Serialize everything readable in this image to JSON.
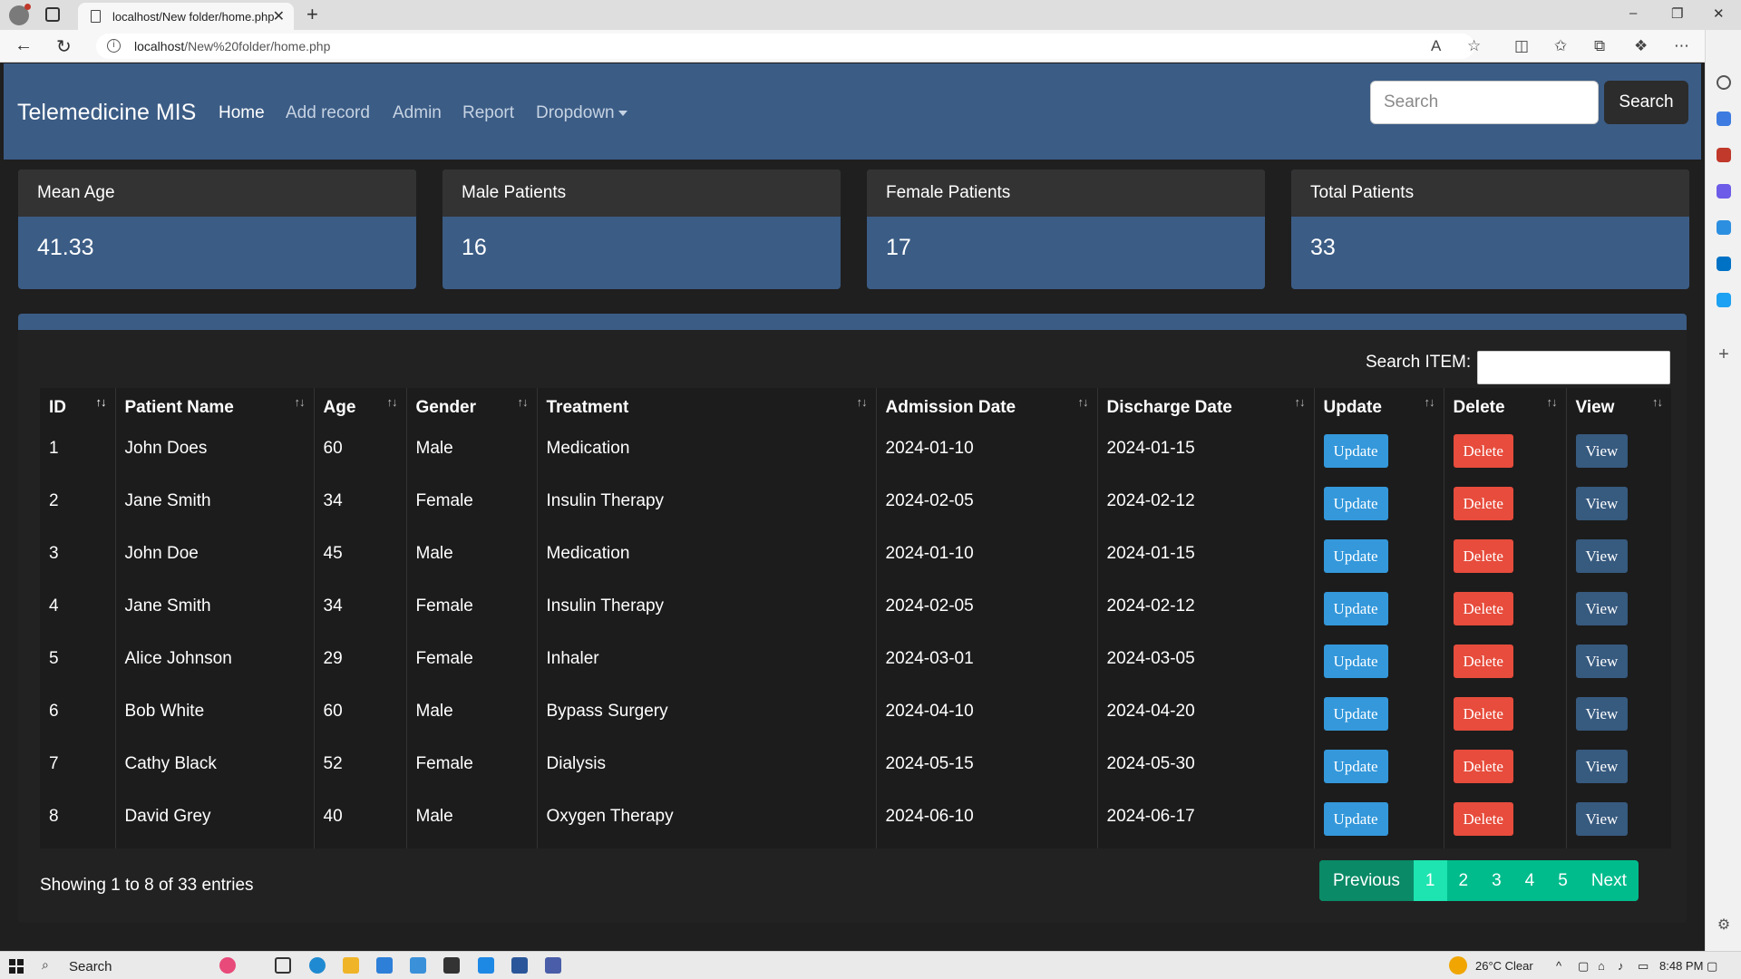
{
  "browser": {
    "tab_title": "localhost/New folder/home.php",
    "url_host": "localhost",
    "url_path": "/New%20folder/home.php"
  },
  "navbar": {
    "brand": "Telemedicine MIS",
    "links": [
      "Home",
      "Add record",
      "Admin",
      "Report",
      "Dropdown"
    ],
    "search_placeholder": "Search",
    "search_button": "Search"
  },
  "stats": [
    {
      "label": "Mean Age",
      "value": "41.33"
    },
    {
      "label": "Male Patients",
      "value": "16"
    },
    {
      "label": "Female Patients",
      "value": "17"
    },
    {
      "label": "Total Patients",
      "value": "33"
    }
  ],
  "table": {
    "search_label": "Search ITEM:",
    "columns": [
      "ID",
      "Patient Name",
      "Age",
      "Gender",
      "Treatment",
      "Admission Date",
      "Discharge Date",
      "Update",
      "Delete",
      "View"
    ],
    "rows": [
      [
        "1",
        "John Does",
        "60",
        "Male",
        "Medication",
        "2024-01-10",
        "2024-01-15"
      ],
      [
        "2",
        "Jane Smith",
        "34",
        "Female",
        "Insulin Therapy",
        "2024-02-05",
        "2024-02-12"
      ],
      [
        "3",
        "John Doe",
        "45",
        "Male",
        "Medication",
        "2024-01-10",
        "2024-01-15"
      ],
      [
        "4",
        "Jane Smith",
        "34",
        "Female",
        "Insulin Therapy",
        "2024-02-05",
        "2024-02-12"
      ],
      [
        "5",
        "Alice Johnson",
        "29",
        "Female",
        "Inhaler",
        "2024-03-01",
        "2024-03-05"
      ],
      [
        "6",
        "Bob White",
        "60",
        "Male",
        "Bypass Surgery",
        "2024-04-10",
        "2024-04-20"
      ],
      [
        "7",
        "Cathy Black",
        "52",
        "Female",
        "Dialysis",
        "2024-05-15",
        "2024-05-30"
      ],
      [
        "8",
        "David Grey",
        "40",
        "Male",
        "Oxygen Therapy",
        "2024-06-10",
        "2024-06-17"
      ]
    ],
    "action_labels": {
      "update": "Update",
      "delete": "Delete",
      "view": "View"
    },
    "info": "Showing 1 to 8 of 33 entries",
    "pagination": {
      "previous": "Previous",
      "pages": [
        "1",
        "2",
        "3",
        "4",
        "5"
      ],
      "active": "1",
      "next": "Next"
    }
  },
  "taskbar": {
    "search_label": "Search",
    "weather": "26°C  Clear",
    "time": "8:48 PM"
  },
  "colors": {
    "navbar": "#3b5c85",
    "update": "#3498db",
    "delete": "#e74c3c",
    "view": "#375a7f",
    "pagination": "#00bc8c"
  }
}
